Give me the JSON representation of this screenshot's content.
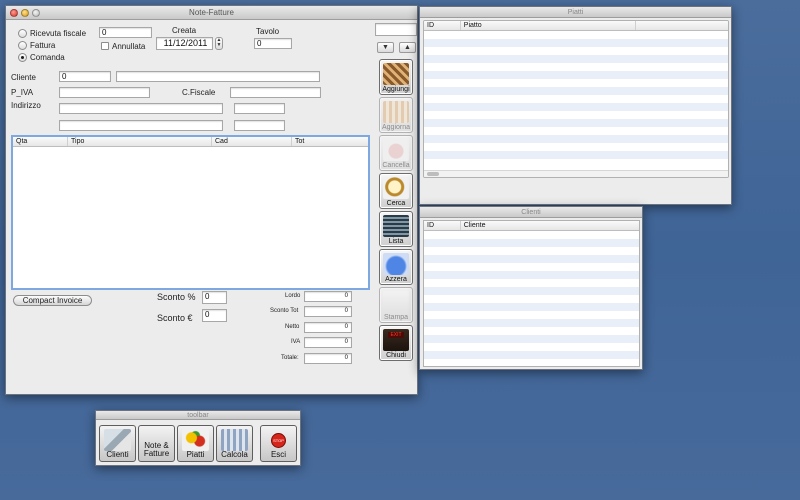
{
  "note_window": {
    "title": "Note-Fatture",
    "doc_types": [
      {
        "label": "Ricevuta fiscale",
        "selected": false
      },
      {
        "label": "Fattura",
        "selected": false
      },
      {
        "label": "Comanda",
        "selected": true
      }
    ],
    "number_value": "0",
    "annullata_label": "Annullata",
    "annullata_checked": false,
    "creata_label": "Creata",
    "creata_value": "11/12/2011",
    "tavolo_label": "Tavolo",
    "tavolo_value": "0",
    "search_value": "",
    "cliente_label": "Cliente",
    "cliente_code": "0",
    "cliente_name": "",
    "piva_label": "P_IVA",
    "piva_value": "",
    "cfiscale_label": "C.Fiscale",
    "cfiscale_value": "",
    "indirizzo_label": "Indirizzo",
    "items_table": {
      "columns": [
        "Qta",
        "Tipo",
        "Cad",
        "Tot"
      ],
      "rows": []
    },
    "compact_invoice_label": "Compact Invoice",
    "sconto_pct_label": "Sconto %",
    "sconto_pct_value": "0",
    "sconto_eur_label": "Sconto €",
    "sconto_eur_value": "0",
    "totals": [
      {
        "label": "Lordo",
        "value": "0"
      },
      {
        "label": "Sconto Tot",
        "value": "0"
      },
      {
        "label": "Netto",
        "value": "0"
      },
      {
        "label": "IVA",
        "value": "0"
      },
      {
        "label": "Totale:",
        "value": "0"
      }
    ],
    "side_buttons": [
      {
        "label": "Aggiungi",
        "enabled": true,
        "icon": "add-icon"
      },
      {
        "label": "Aggiorna",
        "enabled": false,
        "icon": "refresh-icon"
      },
      {
        "label": "Cancella",
        "enabled": false,
        "icon": "trash-icon"
      },
      {
        "label": "Cerca",
        "enabled": true,
        "icon": "magnifier-icon"
      },
      {
        "label": "Lista",
        "enabled": true,
        "icon": "list-icon"
      },
      {
        "label": "Azzera",
        "enabled": true,
        "icon": "eraser-icon"
      },
      {
        "label": "Stampa",
        "enabled": false,
        "icon": "printer-icon"
      },
      {
        "label": "Chiudi",
        "enabled": true,
        "icon": "exit-icon",
        "badge": "EXIT"
      }
    ]
  },
  "piatti_window": {
    "title": "Piatti",
    "columns": [
      "ID",
      "Piatto"
    ]
  },
  "clienti_window": {
    "title": "Clienti",
    "columns": [
      "ID",
      "Cliente"
    ]
  },
  "toolbar_window": {
    "title": "toolbar",
    "buttons": [
      {
        "label": "Clienti",
        "icon": "clients-icon"
      },
      {
        "label": "Note & Fatture",
        "icon": "invoices-icon"
      },
      {
        "label": "Piatti",
        "icon": "dishes-icon"
      },
      {
        "label": "Calcola",
        "icon": "calculator-icon"
      },
      {
        "label": "Esci",
        "icon": "stop-icon",
        "badge": "STOP"
      }
    ]
  },
  "colors": {
    "desktop": "#4a6d9c",
    "stripe": "#e9eff9",
    "focus": "#7ea8e0"
  }
}
